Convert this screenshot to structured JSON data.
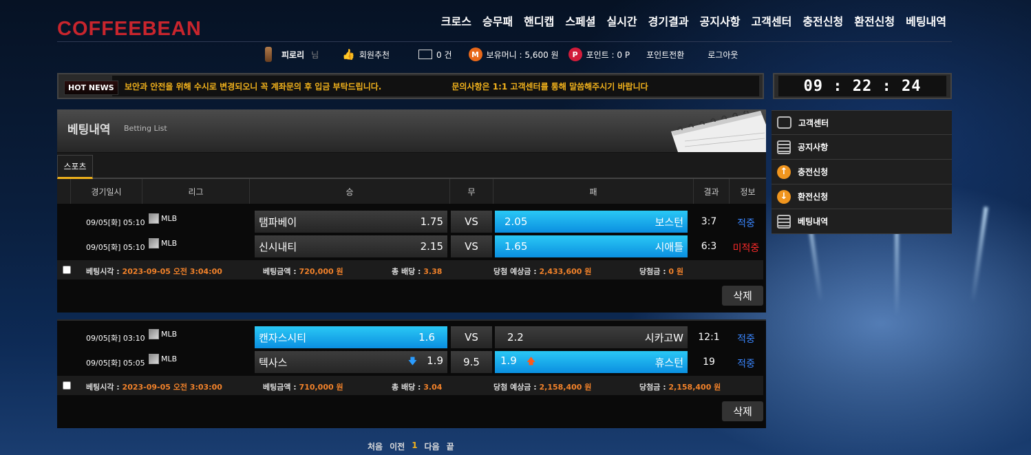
{
  "brand": "COFFEEBEAN",
  "nav": [
    "크로스",
    "승무패",
    "핸디캡",
    "스페셜",
    "실시간",
    "경기결과",
    "공지사항",
    "고객센터",
    "충전신청",
    "환전신청",
    "베팅내역"
  ],
  "userbar": {
    "username": "피로리",
    "honorific": "님",
    "recommend": "회원추천",
    "messages": "0 건",
    "money_icon": "M",
    "money": "보유머니 : 5,600 원",
    "point_icon": "P",
    "points": "포인트 : 0 P",
    "convert": "포인트전환",
    "logout": "로그아웃"
  },
  "news": {
    "badge": "HOT NEWS",
    "messages": [
      "보안과 안전을 위해 수시로 변경되오니 꼭 계좌문의 후 입금 부탁드립니다.",
      "문의사항은 1:1 고객센터를 통해 말씀해주시기 바랍니다"
    ]
  },
  "clock": "09 : 22 : 24",
  "sidebar": [
    {
      "label": "고객센터",
      "icon": "chat-icon"
    },
    {
      "label": "공지사항",
      "icon": "list-icon"
    },
    {
      "label": "충전신청",
      "icon": "arrow-up-icon"
    },
    {
      "label": "환전신청",
      "icon": "arrow-down-icon"
    },
    {
      "label": "베팅내역",
      "icon": "list-icon"
    }
  ],
  "page": {
    "title": "베팅내역",
    "subtitle": "Betting List",
    "tab": "스포츠"
  },
  "columns": [
    "경기일시",
    "리그",
    "승",
    "무",
    "패",
    "결과",
    "정보"
  ],
  "bets": [
    {
      "games": [
        {
          "date": "09/05[화] 05:10",
          "league": "MLB",
          "home": "탬파베이",
          "home_odds": "1.75",
          "draw": "VS",
          "away_odds": "2.05",
          "away": "보스턴",
          "score": "3:7",
          "status": "적중"
        },
        {
          "date": "09/05[화] 05:10",
          "league": "MLB",
          "home": "신시내티",
          "home_odds": "2.15",
          "draw": "VS",
          "away_odds": "1.65",
          "away": "시애틀",
          "score": "6:3",
          "status": "미적중"
        }
      ],
      "summary": {
        "time_label": "베팅시각 : ",
        "time": "2023-09-05 오전 3:04:00",
        "amount_label": "베팅금액 : ",
        "amount": "720,000 원",
        "odds_label": "총 배당 : ",
        "odds": "3.38",
        "expected_label": "당첨 예상금 : ",
        "expected": "2,433,600 원",
        "win_label": "당첨금 : ",
        "win": "0 원"
      },
      "delete": "삭제"
    },
    {
      "games": [
        {
          "date": "09/05[화] 03:10",
          "league": "MLB",
          "home": "캔자스시티",
          "home_odds": "1.6",
          "draw": "VS",
          "away_odds": "2.2",
          "away": "시카고W",
          "score": "12:1",
          "status": "적중"
        },
        {
          "date": "09/05[화] 05:05",
          "league": "MLB",
          "home": "텍사스",
          "home_odds": "1.9",
          "draw": "9.5",
          "away_odds": "1.9",
          "away": "휴스턴",
          "score": "19",
          "status": "적중"
        }
      ],
      "summary": {
        "time_label": "베팅시각 : ",
        "time": "2023-09-05 오전 3:03:00",
        "amount_label": "베팅금액 : ",
        "amount": "710,000 원",
        "odds_label": "총 배당 : ",
        "odds": "3.04",
        "expected_label": "당첨 예상금 : ",
        "expected": "2,158,400 원",
        "win_label": "당첨금 : ",
        "win": "2,158,400 원"
      },
      "delete": "삭제"
    }
  ],
  "pager": {
    "first": "처음",
    "prev": "이전",
    "current": "1",
    "next": "다음",
    "last": "끝"
  }
}
